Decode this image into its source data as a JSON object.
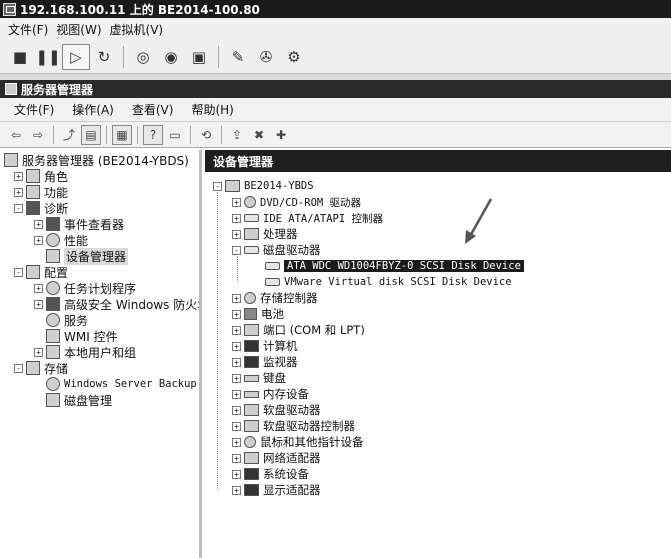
{
  "vm_window": {
    "title": "192.168.100.11 上的 BE2014-100.80",
    "menu": [
      "文件(F)",
      "视图(W)",
      "虚拟机(V)"
    ],
    "toolbar_icons": [
      "stop-icon",
      "pause-icon",
      "play-icon",
      "reset-icon",
      "snapshot-icon",
      "snapshot-revert-icon",
      "snapshot-manager-icon",
      "edit-icon",
      "tools-icon",
      "settings-icon"
    ]
  },
  "server_manager": {
    "title": "服务器管理器",
    "menu": [
      "文件(F)",
      "操作(A)",
      "查看(V)",
      "帮助(H)"
    ],
    "left_tree": [
      {
        "label": "服务器管理器 (BE2014-YBDS)",
        "level": 0,
        "expander": ""
      },
      {
        "label": "角色",
        "level": 1,
        "expander": "+"
      },
      {
        "label": "功能",
        "level": 1,
        "expander": "+"
      },
      {
        "label": "诊断",
        "level": 1,
        "expander": "-"
      },
      {
        "label": "事件查看器",
        "level": 2,
        "expander": "+"
      },
      {
        "label": "性能",
        "level": 2,
        "expander": "+"
      },
      {
        "label": "设备管理器",
        "level": 2,
        "expander": "",
        "selected": true
      },
      {
        "label": "配置",
        "level": 1,
        "expander": "-"
      },
      {
        "label": "任务计划程序",
        "level": 2,
        "expander": "+"
      },
      {
        "label": "高级安全 Windows 防火墙",
        "level": 2,
        "expander": "+"
      },
      {
        "label": "服务",
        "level": 2,
        "expander": ""
      },
      {
        "label": "WMI 控件",
        "level": 2,
        "expander": ""
      },
      {
        "label": "本地用户和组",
        "level": 2,
        "expander": "+"
      },
      {
        "label": "存储",
        "level": 1,
        "expander": "-"
      },
      {
        "label": "Windows Server Backup",
        "level": 2,
        "expander": ""
      },
      {
        "label": "磁盘管理",
        "level": 2,
        "expander": ""
      }
    ],
    "right_title": "设备管理器",
    "device_tree": [
      {
        "label": "BE2014-YBDS",
        "level": 0,
        "expander": "-",
        "icon": "computer-icon"
      },
      {
        "label": "DVD/CD-ROM 驱动器",
        "level": 1,
        "expander": "+",
        "icon": "dvd-icon"
      },
      {
        "label": "IDE ATA/ATAPI 控制器",
        "level": 1,
        "expander": "+",
        "icon": "ide-icon"
      },
      {
        "label": "处理器",
        "level": 1,
        "expander": "+",
        "icon": "processor-icon"
      },
      {
        "label": "磁盘驱动器",
        "level": 1,
        "expander": "-",
        "icon": "disk-icon"
      },
      {
        "label": "ATA WDC WD1004FBYZ-0 SCSI Disk Device",
        "level": 2,
        "expander": "",
        "icon": "disk-icon",
        "highlighted": true
      },
      {
        "label": "VMware Virtual disk SCSI Disk Device",
        "level": 2,
        "expander": "",
        "icon": "disk-icon"
      },
      {
        "label": "存储控制器",
        "level": 1,
        "expander": "+",
        "icon": "storage-controller-icon"
      },
      {
        "label": "电池",
        "level": 1,
        "expander": "+",
        "icon": "battery-icon"
      },
      {
        "label": "端口 (COM 和 LPT)",
        "level": 1,
        "expander": "+",
        "icon": "port-icon"
      },
      {
        "label": "计算机",
        "level": 1,
        "expander": "+",
        "icon": "computer-icon"
      },
      {
        "label": "监视器",
        "level": 1,
        "expander": "+",
        "icon": "monitor-icon"
      },
      {
        "label": "键盘",
        "level": 1,
        "expander": "+",
        "icon": "keyboard-icon"
      },
      {
        "label": "内存设备",
        "level": 1,
        "expander": "+",
        "icon": "memory-icon"
      },
      {
        "label": "软盘驱动器",
        "level": 1,
        "expander": "+",
        "icon": "floppy-icon"
      },
      {
        "label": "软盘驱动器控制器",
        "level": 1,
        "expander": "+",
        "icon": "floppy-controller-icon"
      },
      {
        "label": "鼠标和其他指针设备",
        "level": 1,
        "expander": "+",
        "icon": "mouse-icon"
      },
      {
        "label": "网络适配器",
        "level": 1,
        "expander": "+",
        "icon": "network-icon"
      },
      {
        "label": "系统设备",
        "level": 1,
        "expander": "+",
        "icon": "system-icon"
      },
      {
        "label": "显示适配器",
        "level": 1,
        "expander": "+",
        "icon": "display-adapter-icon"
      }
    ]
  },
  "colors": {
    "titlebar": "#1a1a1a",
    "highlight": "#1b1b1b",
    "chrome": "#efefef"
  }
}
